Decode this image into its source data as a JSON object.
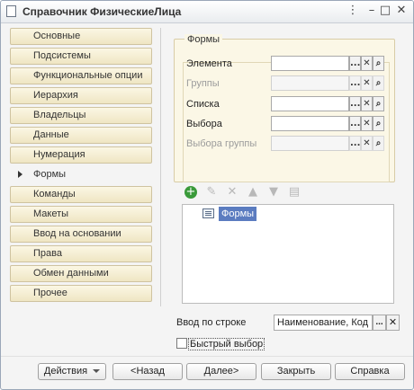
{
  "window": {
    "title": "Справочник ФизическиеЛица"
  },
  "sidebar": {
    "items": [
      {
        "label": "Основные"
      },
      {
        "label": "Подсистемы"
      },
      {
        "label": "Функциональные опции"
      },
      {
        "label": "Иерархия"
      },
      {
        "label": "Владельцы"
      },
      {
        "label": "Данные"
      },
      {
        "label": "Нумерация"
      },
      {
        "label": "Формы",
        "active": true
      },
      {
        "label": "Команды"
      },
      {
        "label": "Макеты"
      },
      {
        "label": "Ввод на основании"
      },
      {
        "label": "Права"
      },
      {
        "label": "Обмен данными"
      },
      {
        "label": "Прочее"
      }
    ]
  },
  "forms_group": {
    "title": "Формы",
    "rows": [
      {
        "label": "Элемента",
        "value": "",
        "enabled": true
      },
      {
        "label": "Группы",
        "value": "",
        "enabled": false
      },
      {
        "label": "Списка",
        "value": "",
        "enabled": true
      },
      {
        "label": "Выбора",
        "value": "",
        "enabled": true
      },
      {
        "label": "Выбора группы",
        "value": "",
        "enabled": false
      }
    ],
    "dots_glyph": "...",
    "clear_glyph": "✕",
    "open_glyph": "🔍"
  },
  "tree": {
    "items": [
      {
        "label": "Формы",
        "icon": "form-icon",
        "selected": true
      }
    ]
  },
  "input_by_string": {
    "label": "Ввод по строке",
    "value": "Наименование, Код",
    "dots_glyph": "...",
    "clear_glyph": "✕"
  },
  "quick_choice": {
    "label": "Быстрый выбор",
    "checked": false
  },
  "buttons": {
    "actions": "Действия",
    "back": "<Назад",
    "next": "Далее>",
    "close": "Закрыть",
    "help": "Справка"
  },
  "colors": {
    "tab_bg": "#efe6c3",
    "group_bg": "#fbf7e6",
    "selection": "#5b7cc0",
    "add_icon": "#3a9a3a"
  }
}
